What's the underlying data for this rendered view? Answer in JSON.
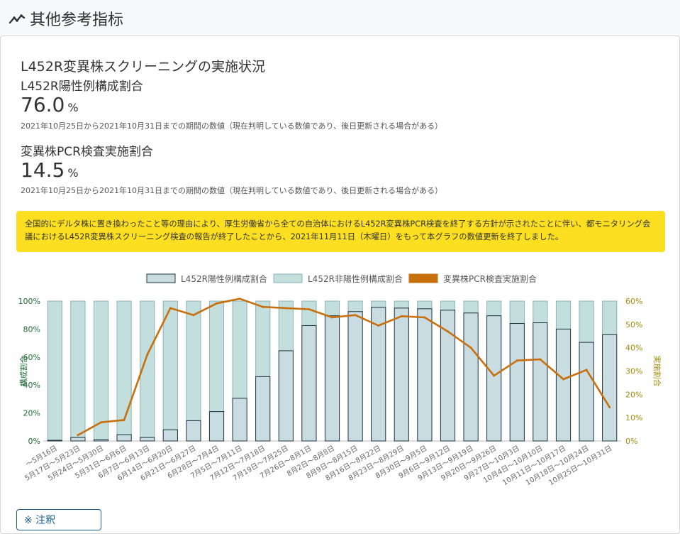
{
  "section": {
    "title": "其他参考指标",
    "icon": "trend-line-icon"
  },
  "card": {
    "title": "L452R変異株スクリーニングの実施状況",
    "metrics": [
      {
        "label": "L452R陽性例構成割合",
        "value": "76.0",
        "unit": "%",
        "note": "2021年10月25日から2021年10月31日までの期間の数値（現在判明している数値であり、後日更新される場合がある）"
      },
      {
        "label": "変異株PCR検査実施割合",
        "value": "14.5",
        "unit": "%",
        "note": "2021年10月25日から2021年10月31日までの期間の数値（現在判明している数値であり、後日更新される場合がある）"
      }
    ],
    "notice": "全国的にデルタ株に置き換わったこと等の理由により、厚生労働省から全ての自治体におけるL452R変異株PCR検査を終了する方針が示されたことに伴い、都モニタリング会議におけるL452R変異株スクリーニング検査の報告が終了したことから、2021年11月11日（木曜日）をもって本グラフの数値更新を終了しました。",
    "button_label": "※ 注釈"
  },
  "colors": {
    "positive": "#c9dce2",
    "negative": "#c2dedd",
    "line": "#c8700d",
    "notice": "#fcdf20",
    "left_axis": "#1b6b33",
    "right_axis": "#a08a0c"
  },
  "chart_data": {
    "type": "bar",
    "legend_position": "top",
    "categories": [
      "〜5月16日",
      "5月17日〜5月23日",
      "5月24日〜5月30日",
      "5月31日〜6月6日",
      "6月7日〜6月13日",
      "6月14日〜6月20日",
      "6月21日〜6月27日",
      "6月28日〜7月4日",
      "7月5日〜7月11日",
      "7月12日〜7月18日",
      "7月19日〜7月25日",
      "7月26日〜8月1日",
      "8月2日〜8月8日",
      "8月9日〜8月15日",
      "8月16日〜8月22日",
      "8月23日〜8月29日",
      "8月30日〜9月5日",
      "9月6日〜9月12日",
      "9月13日〜9月19日",
      "9月20日〜9月26日",
      "9月27日〜10月3日",
      "10月4日〜10月10日",
      "10月11日〜10月17日",
      "10月18日〜10月24日",
      "10月25日〜10月31日"
    ],
    "series": [
      {
        "name": "L452R陽性例構成割合",
        "axis": "left",
        "kind": "bar",
        "values": [
          0.5,
          2.5,
          1.0,
          4.5,
          2.5,
          8.0,
          14.5,
          21.0,
          30.5,
          46.0,
          64.5,
          82.5,
          89.5,
          92.5,
          95.5,
          95.0,
          94.5,
          93.5,
          91.5,
          89.5,
          84.0,
          84.5,
          80.0,
          70.5,
          76.0
        ]
      },
      {
        "name": "L452R非陽性例構成割合",
        "axis": "left",
        "kind": "bar",
        "values": [
          99.5,
          97.5,
          99.0,
          95.5,
          97.5,
          92.0,
          85.5,
          79.0,
          69.5,
          54.0,
          35.5,
          17.5,
          10.5,
          7.5,
          4.5,
          5.0,
          5.5,
          6.5,
          8.5,
          10.5,
          16.0,
          15.5,
          20.0,
          29.5,
          24.0
        ]
      },
      {
        "name": "変異株PCR検査実施割合",
        "axis": "right",
        "kind": "line",
        "values": [
          2.5,
          8.0,
          9.0,
          37.0,
          57.0,
          54.0,
          59.0,
          61.0,
          57.5,
          57.0,
          56.5,
          53.0,
          54.0,
          49.5,
          53.5,
          53.0,
          47.0,
          40.0,
          28.0,
          34.5,
          35.0,
          26.5,
          30.5,
          14.5
        ]
      }
    ],
    "y_left": {
      "label": "構成割合",
      "min": 0,
      "max": 100,
      "ticks": [
        "0%",
        "20%",
        "40%",
        "60%",
        "80%",
        "100%"
      ]
    },
    "y_right": {
      "label": "実施割合",
      "min": 0,
      "max": 60,
      "ticks": [
        "0%",
        "10%",
        "20%",
        "30%",
        "40%",
        "50%",
        "60%"
      ]
    }
  }
}
